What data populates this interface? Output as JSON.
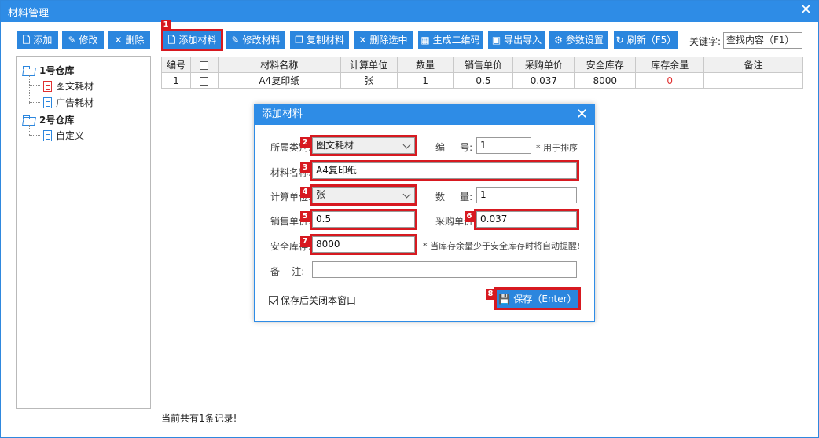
{
  "window": {
    "title": "材料管理",
    "close_icon": "close-icon"
  },
  "toolbar_left": [
    {
      "name": "add-button",
      "label": "添加",
      "icon": "add-doc-icon"
    },
    {
      "name": "edit-button",
      "label": "修改",
      "icon": "edit-icon"
    },
    {
      "name": "delete-button",
      "label": "删除",
      "icon": "close-icon"
    }
  ],
  "toolbar_right": [
    {
      "name": "add-material-button",
      "label": "添加材料",
      "icon": "add-doc-icon"
    },
    {
      "name": "edit-material-button",
      "label": "修改材料",
      "icon": "edit-icon"
    },
    {
      "name": "copy-material-button",
      "label": "复制材料",
      "icon": "copy-icon"
    },
    {
      "name": "delete-selected-button",
      "label": "删除选中",
      "icon": "close-icon"
    },
    {
      "name": "generate-qrcode-button",
      "label": "生成二维码",
      "icon": "qrcode-icon"
    },
    {
      "name": "export-import-button",
      "label": "导出导入",
      "icon": "excel-icon"
    },
    {
      "name": "settings-button",
      "label": "参数设置",
      "icon": "gear-icon"
    },
    {
      "name": "refresh-button",
      "label": "刷新（F5）",
      "icon": "refresh-icon"
    }
  ],
  "search": {
    "label": "关键字:",
    "value": "查找内容（F1）"
  },
  "tree": [
    {
      "label": "1号仓库",
      "type": "warehouse",
      "icon": "folder-icon"
    },
    {
      "label": "图文耗材",
      "type": "category",
      "icon": "document-icon",
      "color": "#e03030"
    },
    {
      "label": "广告耗材",
      "type": "category",
      "icon": "document-icon",
      "color": "#2b86de"
    },
    {
      "label": "2号仓库",
      "type": "warehouse",
      "icon": "folder-icon"
    },
    {
      "label": "自定义",
      "type": "category",
      "icon": "document-icon",
      "color": "#2b86de"
    }
  ],
  "table": {
    "headers": [
      "编号",
      "",
      "材料名称",
      "计算单位",
      "数量",
      "销售单价",
      "采购单价",
      "安全库存",
      "库存余量",
      "备注"
    ],
    "rows": [
      {
        "id": "1",
        "name": "A4复印纸",
        "unit": "张",
        "qty": "1",
        "sale_price": "0.5",
        "purchase_price": "0.037",
        "safe_stock": "8000",
        "remaining": "0",
        "remark": ""
      }
    ]
  },
  "footer": {
    "record_text": "当前共有1条记录!"
  },
  "dialog": {
    "title": "添加材料",
    "category_label": "所属类别:",
    "category_value": "图文耗材",
    "number_label": "编     号:",
    "number_value": "1",
    "number_note": "* 用于排序",
    "name_label": "材料名称:",
    "name_value": "A4复印纸",
    "unit_label": "计算单位:",
    "unit_value": "张",
    "qty_label": "数     量:",
    "qty_value": "1",
    "sale_label": "销售单价:",
    "sale_value": "0.5",
    "purchase_label": "采购单价:",
    "purchase_value": "0.037",
    "safe_label": "安全库存:",
    "safe_value": "8000",
    "safe_note": "* 当库存余量少于安全库存时将自动提醒!",
    "remark_label": "备    注:",
    "remark_value": "",
    "close_after_save": "保存后关闭本窗口",
    "save_label": "保存（Enter）"
  },
  "annotations": [
    "1",
    "2",
    "3",
    "4",
    "5",
    "6",
    "7",
    "8"
  ],
  "colors": {
    "accent": "#2e8ce6",
    "highlight": "#d71920",
    "warning_text": "#e03030"
  }
}
